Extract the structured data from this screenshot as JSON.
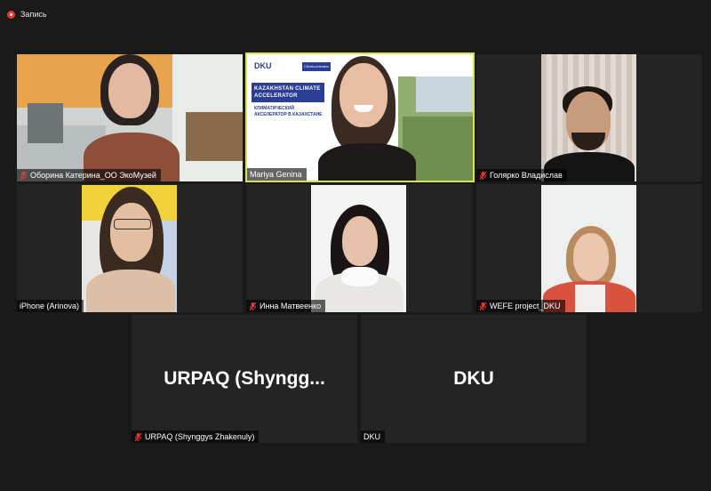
{
  "recording": {
    "label": "Запись",
    "icon": "record-icon"
  },
  "participants": [
    {
      "name": "Оборина Катерина_ОО ЭкоМузей",
      "muted": true
    },
    {
      "name": "Mariya Genina",
      "muted": false,
      "active_speaker": true
    },
    {
      "name": "Голярко Владислав",
      "muted": true
    },
    {
      "name": "iPhone (Arinova)",
      "muted": false
    },
    {
      "name": "Инна Матвеенко",
      "muted": true
    },
    {
      "name": "WEFE project_DKU",
      "muted": true
    },
    {
      "name": "URPAQ (Shynggys Zhakenuly)",
      "display": "URPAQ  (Shyngg...",
      "muted": true,
      "video_off": true
    },
    {
      "name": "DKU",
      "display": "DKU",
      "muted": false,
      "video_off": true
    }
  ],
  "slide": {
    "logo_left": "DKU",
    "logo_right": "ClimAccelerator",
    "title_en": "KAZAKHSTAN  CLIMATE ACCELERATOR",
    "title_ru": "КЛИМАТИЧЕСКИЙ АКСЕЛЕРАТОР В КАЗАХСТАНЕ"
  },
  "colors": {
    "background": "#1a1a1a",
    "tile": "#242424",
    "active_border": "#d7e34a",
    "mute": "#e53935"
  }
}
